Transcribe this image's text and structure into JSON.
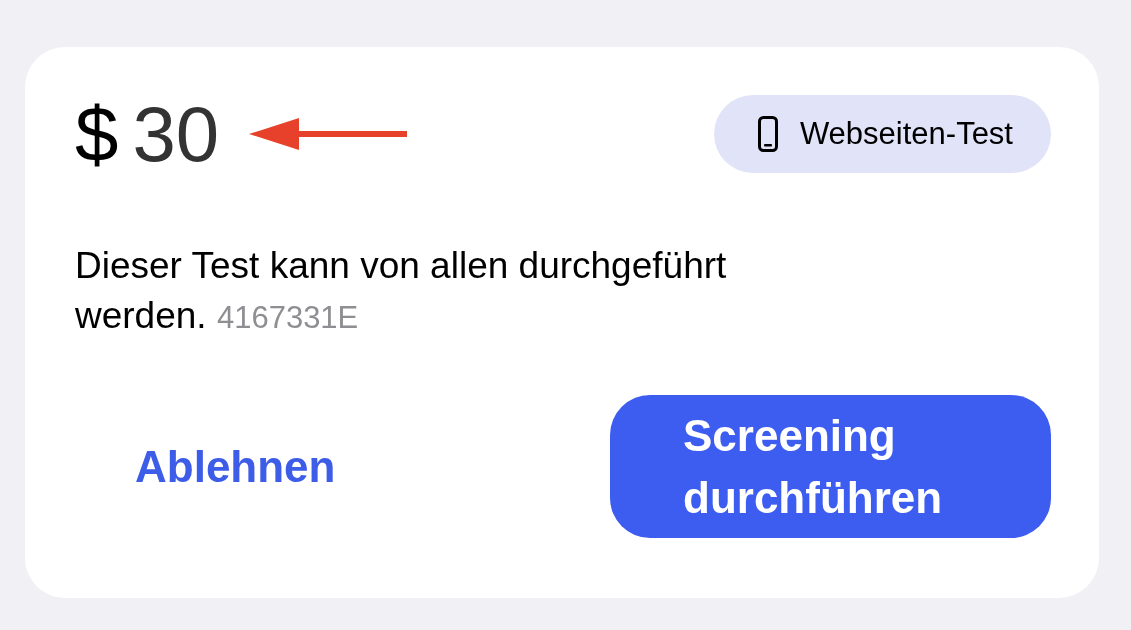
{
  "offer": {
    "currency": "$",
    "amount": "30",
    "badge": {
      "label": "Webseiten-Test"
    },
    "description": "Dieser Test kann von allen durchgeführt werden.",
    "code": "4167331E"
  },
  "buttons": [
    {
      "kind": "text",
      "label": "Ablehnen"
    },
    {
      "kind": "filled",
      "label": "Screening durchführen"
    }
  ]
}
